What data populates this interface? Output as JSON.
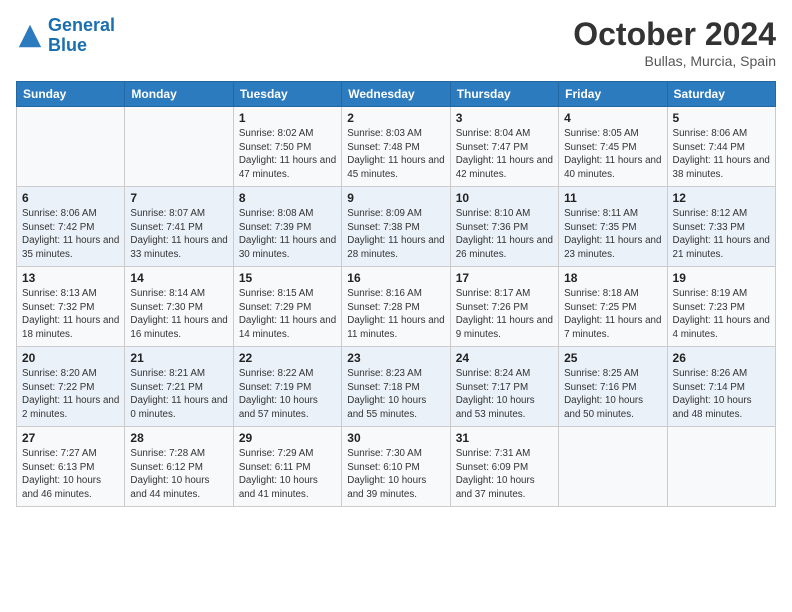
{
  "header": {
    "logo_general": "General",
    "logo_blue": "Blue",
    "month": "October 2024",
    "location": "Bullas, Murcia, Spain"
  },
  "days_of_week": [
    "Sunday",
    "Monday",
    "Tuesday",
    "Wednesday",
    "Thursday",
    "Friday",
    "Saturday"
  ],
  "weeks": [
    [
      {
        "day": "",
        "info": ""
      },
      {
        "day": "",
        "info": ""
      },
      {
        "day": "1",
        "info": "Sunrise: 8:02 AM\nSunset: 7:50 PM\nDaylight: 11 hours and 47 minutes."
      },
      {
        "day": "2",
        "info": "Sunrise: 8:03 AM\nSunset: 7:48 PM\nDaylight: 11 hours and 45 minutes."
      },
      {
        "day": "3",
        "info": "Sunrise: 8:04 AM\nSunset: 7:47 PM\nDaylight: 11 hours and 42 minutes."
      },
      {
        "day": "4",
        "info": "Sunrise: 8:05 AM\nSunset: 7:45 PM\nDaylight: 11 hours and 40 minutes."
      },
      {
        "day": "5",
        "info": "Sunrise: 8:06 AM\nSunset: 7:44 PM\nDaylight: 11 hours and 38 minutes."
      }
    ],
    [
      {
        "day": "6",
        "info": "Sunrise: 8:06 AM\nSunset: 7:42 PM\nDaylight: 11 hours and 35 minutes."
      },
      {
        "day": "7",
        "info": "Sunrise: 8:07 AM\nSunset: 7:41 PM\nDaylight: 11 hours and 33 minutes."
      },
      {
        "day": "8",
        "info": "Sunrise: 8:08 AM\nSunset: 7:39 PM\nDaylight: 11 hours and 30 minutes."
      },
      {
        "day": "9",
        "info": "Sunrise: 8:09 AM\nSunset: 7:38 PM\nDaylight: 11 hours and 28 minutes."
      },
      {
        "day": "10",
        "info": "Sunrise: 8:10 AM\nSunset: 7:36 PM\nDaylight: 11 hours and 26 minutes."
      },
      {
        "day": "11",
        "info": "Sunrise: 8:11 AM\nSunset: 7:35 PM\nDaylight: 11 hours and 23 minutes."
      },
      {
        "day": "12",
        "info": "Sunrise: 8:12 AM\nSunset: 7:33 PM\nDaylight: 11 hours and 21 minutes."
      }
    ],
    [
      {
        "day": "13",
        "info": "Sunrise: 8:13 AM\nSunset: 7:32 PM\nDaylight: 11 hours and 18 minutes."
      },
      {
        "day": "14",
        "info": "Sunrise: 8:14 AM\nSunset: 7:30 PM\nDaylight: 11 hours and 16 minutes."
      },
      {
        "day": "15",
        "info": "Sunrise: 8:15 AM\nSunset: 7:29 PM\nDaylight: 11 hours and 14 minutes."
      },
      {
        "day": "16",
        "info": "Sunrise: 8:16 AM\nSunset: 7:28 PM\nDaylight: 11 hours and 11 minutes."
      },
      {
        "day": "17",
        "info": "Sunrise: 8:17 AM\nSunset: 7:26 PM\nDaylight: 11 hours and 9 minutes."
      },
      {
        "day": "18",
        "info": "Sunrise: 8:18 AM\nSunset: 7:25 PM\nDaylight: 11 hours and 7 minutes."
      },
      {
        "day": "19",
        "info": "Sunrise: 8:19 AM\nSunset: 7:23 PM\nDaylight: 11 hours and 4 minutes."
      }
    ],
    [
      {
        "day": "20",
        "info": "Sunrise: 8:20 AM\nSunset: 7:22 PM\nDaylight: 11 hours and 2 minutes."
      },
      {
        "day": "21",
        "info": "Sunrise: 8:21 AM\nSunset: 7:21 PM\nDaylight: 11 hours and 0 minutes."
      },
      {
        "day": "22",
        "info": "Sunrise: 8:22 AM\nSunset: 7:19 PM\nDaylight: 10 hours and 57 minutes."
      },
      {
        "day": "23",
        "info": "Sunrise: 8:23 AM\nSunset: 7:18 PM\nDaylight: 10 hours and 55 minutes."
      },
      {
        "day": "24",
        "info": "Sunrise: 8:24 AM\nSunset: 7:17 PM\nDaylight: 10 hours and 53 minutes."
      },
      {
        "day": "25",
        "info": "Sunrise: 8:25 AM\nSunset: 7:16 PM\nDaylight: 10 hours and 50 minutes."
      },
      {
        "day": "26",
        "info": "Sunrise: 8:26 AM\nSunset: 7:14 PM\nDaylight: 10 hours and 48 minutes."
      }
    ],
    [
      {
        "day": "27",
        "info": "Sunrise: 7:27 AM\nSunset: 6:13 PM\nDaylight: 10 hours and 46 minutes."
      },
      {
        "day": "28",
        "info": "Sunrise: 7:28 AM\nSunset: 6:12 PM\nDaylight: 10 hours and 44 minutes."
      },
      {
        "day": "29",
        "info": "Sunrise: 7:29 AM\nSunset: 6:11 PM\nDaylight: 10 hours and 41 minutes."
      },
      {
        "day": "30",
        "info": "Sunrise: 7:30 AM\nSunset: 6:10 PM\nDaylight: 10 hours and 39 minutes."
      },
      {
        "day": "31",
        "info": "Sunrise: 7:31 AM\nSunset: 6:09 PM\nDaylight: 10 hours and 37 minutes."
      },
      {
        "day": "",
        "info": ""
      },
      {
        "day": "",
        "info": ""
      }
    ]
  ]
}
